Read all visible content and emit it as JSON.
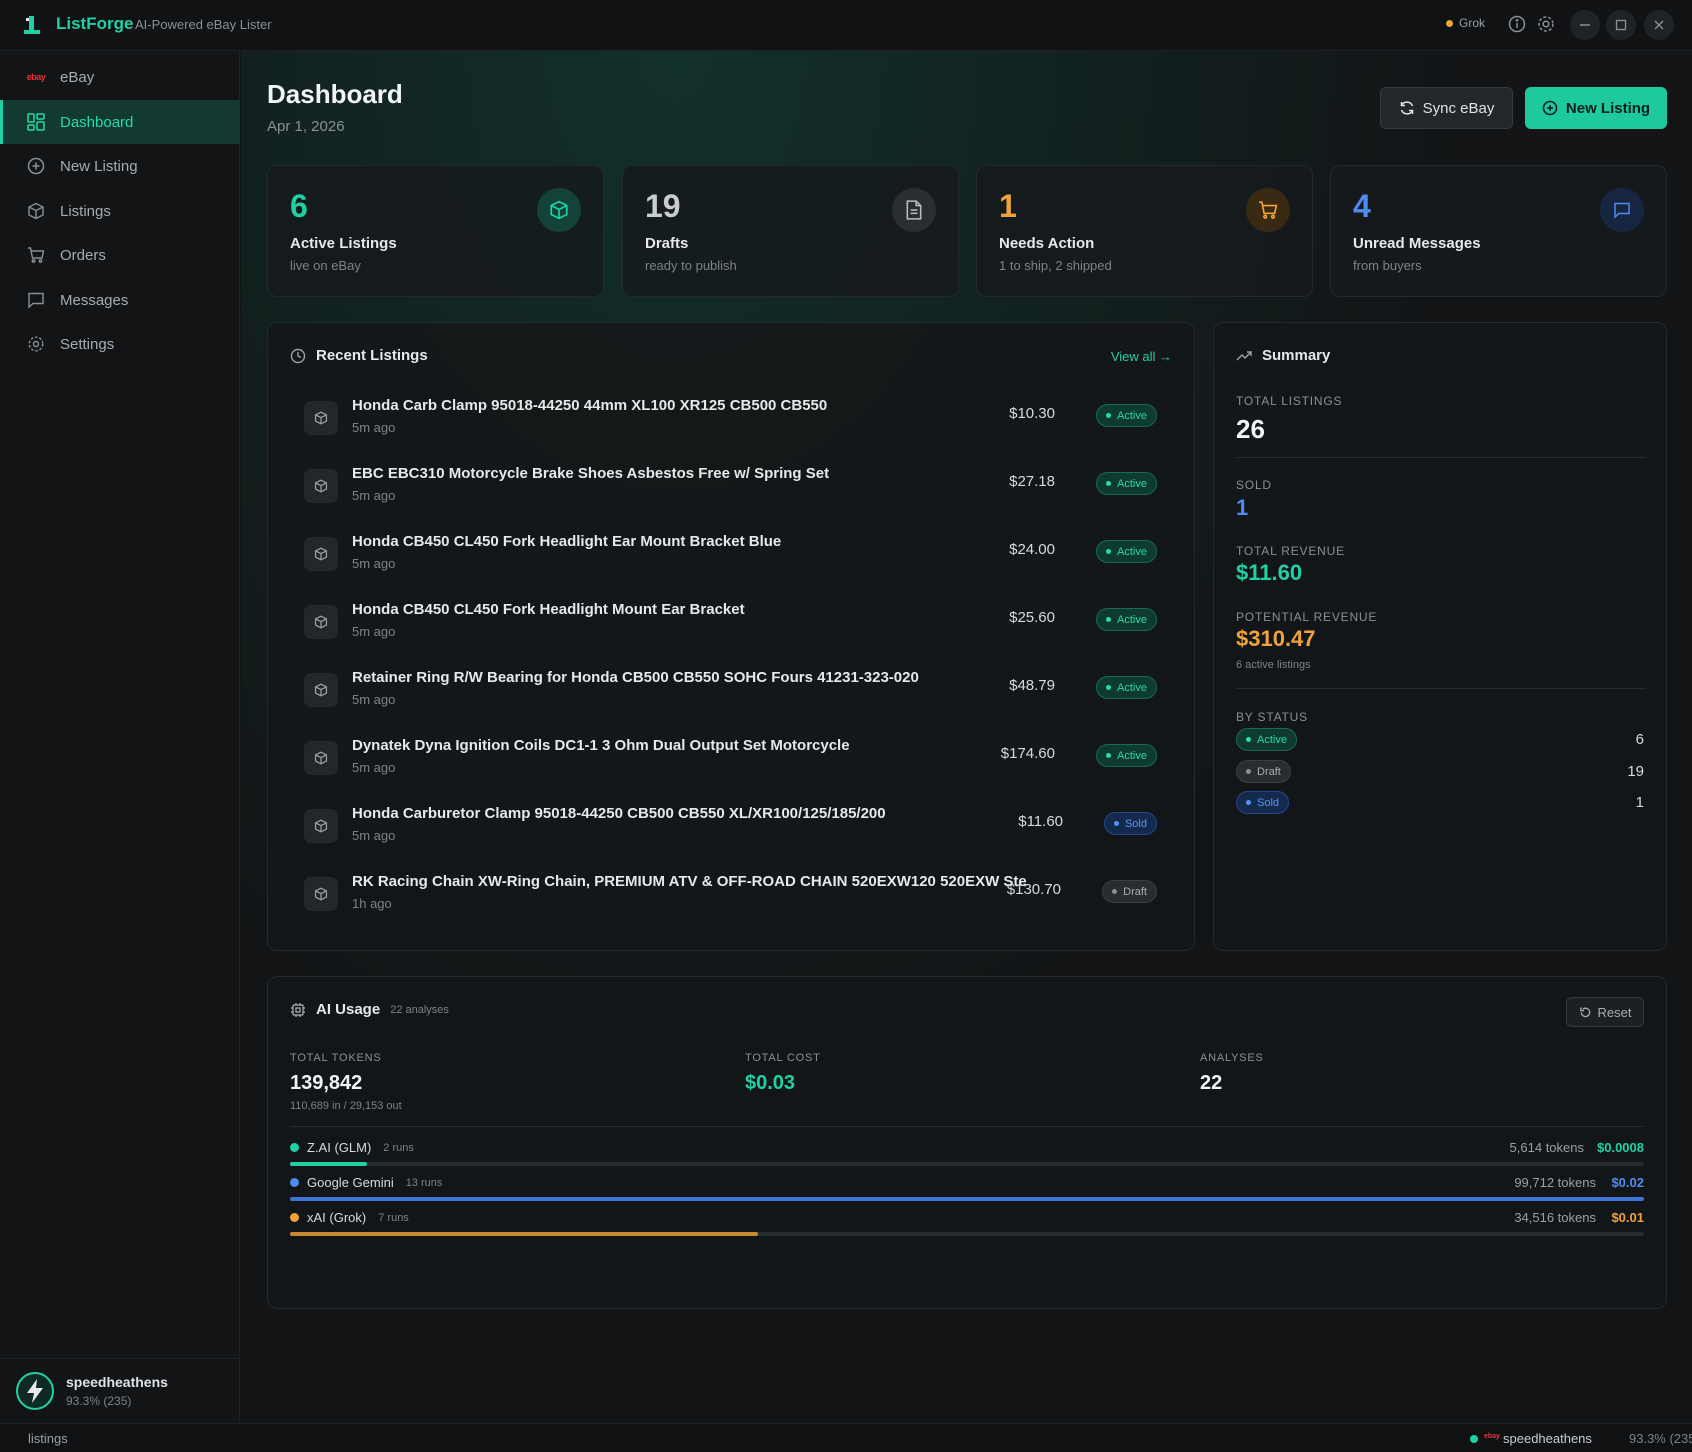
{
  "app": {
    "name": "ListForge",
    "tagline": "AI-Powered eBay Lister",
    "model_label": "Grok"
  },
  "sidebar": {
    "marketplace": "eBay",
    "ebay_logo": "ebay",
    "items": [
      {
        "label": "Dashboard",
        "icon": "dashboard-icon",
        "active": true
      },
      {
        "label": "New Listing",
        "icon": "plus-circle-icon",
        "active": false
      },
      {
        "label": "Listings",
        "icon": "package-icon",
        "active": false
      },
      {
        "label": "Orders",
        "icon": "cart-icon",
        "active": false
      },
      {
        "label": "Messages",
        "icon": "message-icon",
        "active": false
      },
      {
        "label": "Settings",
        "icon": "gear-icon",
        "active": false
      }
    ],
    "user": {
      "name": "speedheathens",
      "score": "93.3% (235)"
    }
  },
  "statusbar": {
    "left": "listings",
    "user": "speedheathens",
    "score": "93.3% (235"
  },
  "header": {
    "title": "Dashboard",
    "date": "Apr 1, 2026",
    "sync_label": "Sync eBay",
    "new_label": "New Listing"
  },
  "stats": [
    {
      "value": "6",
      "label": "Active Listings",
      "sub": "live on eBay",
      "color": "#1fd1a4",
      "icon": "package-icon"
    },
    {
      "value": "19",
      "label": "Drafts",
      "sub": "ready to publish",
      "color": "#c9cdd1",
      "icon": "document-icon"
    },
    {
      "value": "1",
      "label": "Needs Action",
      "sub": "1 to ship, 2 shipped",
      "color": "#f0a23b",
      "icon": "cart-icon"
    },
    {
      "value": "4",
      "label": "Unread Messages",
      "sub": "from buyers",
      "color": "#4f8bf0",
      "icon": "message-icon"
    }
  ],
  "recent": {
    "title": "Recent Listings",
    "view_all": "View all →",
    "rows": [
      {
        "title": "Honda Carb Clamp 95018-44250 44mm XL100 XR125 CB500 CB550",
        "time": "5m ago",
        "price": "$10.30",
        "status": "Active"
      },
      {
        "title": "EBC EBC310 Motorcycle Brake Shoes Asbestos Free w/ Spring Set",
        "time": "5m ago",
        "price": "$27.18",
        "status": "Active"
      },
      {
        "title": "Honda CB450 CL450 Fork Headlight Ear Mount Bracket Blue",
        "time": "5m ago",
        "price": "$24.00",
        "status": "Active"
      },
      {
        "title": "Honda CB450 CL450 Fork Headlight Mount Ear Bracket",
        "time": "5m ago",
        "price": "$25.60",
        "status": "Active"
      },
      {
        "title": "Retainer Ring R/W Bearing for Honda CB500 CB550 SOHC Fours 41231-323-020",
        "time": "5m ago",
        "price": "$48.79",
        "status": "Active"
      },
      {
        "title": "Dynatek Dyna Ignition Coils DC1-1 3 Ohm Dual Output Set Motorcycle",
        "time": "5m ago",
        "price": "$174.60",
        "status": "Active"
      },
      {
        "title": "Honda Carburetor Clamp 95018-44250 CB500 CB550 XL/XR100/125/185/200",
        "time": "5m ago",
        "price": "$11.60",
        "status": "Sold"
      },
      {
        "title": "RK Racing Chain XW-Ring Chain, PREMIUM ATV & OFF-ROAD CHAIN 520EXW120 520EXW Ste",
        "time": "1h ago",
        "price": "$130.70",
        "status": "Draft"
      }
    ]
  },
  "summary": {
    "title": "Summary",
    "total_label": "TOTAL LISTINGS",
    "total_value": "26",
    "sold_label": "SOLD",
    "sold_value": "1",
    "revenue_label": "TOTAL REVENUE",
    "revenue_value": "$11.60",
    "potential_label": "POTENTIAL REVENUE",
    "potential_value": "$310.47",
    "potential_note": "6 active listings",
    "by_status_label": "BY STATUS",
    "statuses": [
      {
        "label": "Active",
        "count": "6"
      },
      {
        "label": "Draft",
        "count": "19"
      },
      {
        "label": "Sold",
        "count": "1"
      }
    ]
  },
  "ai_usage": {
    "title": "AI Usage",
    "analyses_note": "22 analyses",
    "reset_label": "Reset",
    "tokens_label": "TOTAL TOKENS",
    "tokens_value": "139,842",
    "tokens_sub": "110,689 in / 29,153 out",
    "cost_label": "TOTAL COST",
    "cost_value": "$0.03",
    "analyses_label": "ANALYSES",
    "analyses_value": "22",
    "providers": [
      {
        "name": "Z.AI (GLM)",
        "runs": "2 runs",
        "tokens": "5,614 tokens",
        "cost": "$0.0008",
        "color": "#1fd1a4",
        "share": 0.057
      },
      {
        "name": "Google Gemini",
        "runs": "13 runs",
        "tokens": "99,712 tokens",
        "cost": "$0.02",
        "color": "#4f8bf0",
        "share": 1.0
      },
      {
        "name": "xAI (Grok)",
        "runs": "7 runs",
        "tokens": "34,516 tokens",
        "cost": "$0.01",
        "color": "#f0a23b",
        "share": 0.346
      }
    ]
  }
}
